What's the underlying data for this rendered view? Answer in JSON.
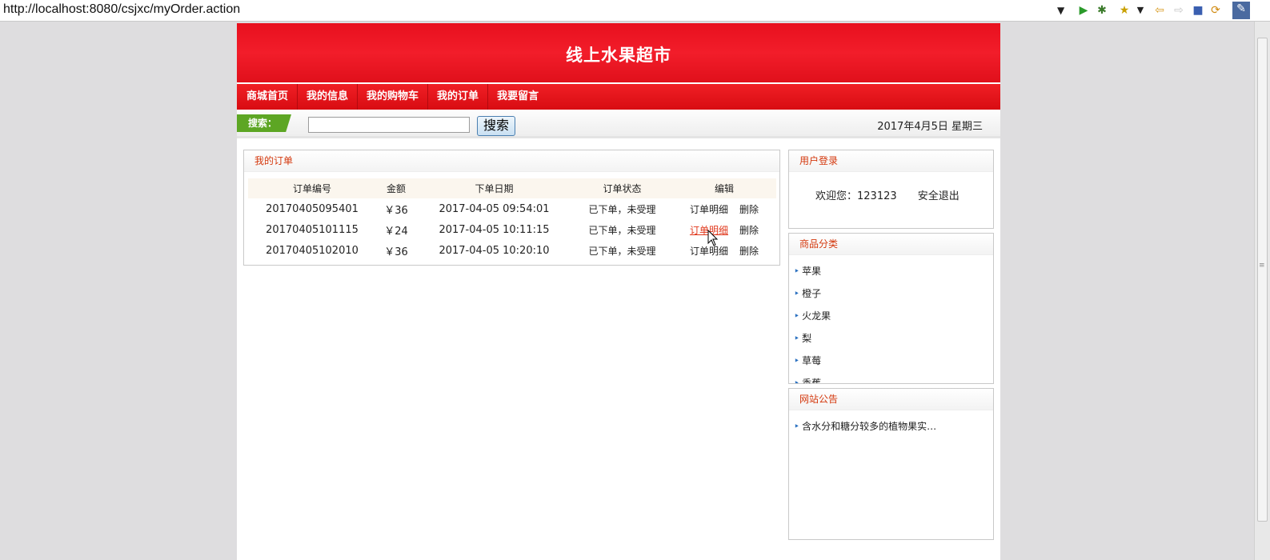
{
  "browser": {
    "url": "http://localhost:8080/csjxc/myOrder.action",
    "icons": [
      "dropdown-icon",
      "run-icon",
      "debug-icon",
      "bookmark-star-icon",
      "menu-arrow-icon",
      "back-icon",
      "forward-icon",
      "stop-icon",
      "refresh-icon",
      "tools-icon"
    ]
  },
  "site": {
    "title": "线上水果超市",
    "nav": [
      "商城首页",
      "我的信息",
      "我的购物车",
      "我的订单",
      "我要留言"
    ]
  },
  "search": {
    "label": "搜索：",
    "value": "",
    "button": "搜索",
    "date": "2017年4月5日  星期三"
  },
  "orders": {
    "title": "我的订单",
    "columns": [
      "订单编号",
      "金额",
      "下单日期",
      "订单状态",
      "编辑"
    ],
    "rows": [
      {
        "id": "20170405095401",
        "amount": "￥36",
        "date": "2017-04-05 09:54:01",
        "status": "已下单，未受理",
        "detail": "订单明细",
        "delete": "删除"
      },
      {
        "id": "20170405101115",
        "amount": "￥24",
        "date": "2017-04-05 10:11:15",
        "status": "已下单，未受理",
        "detail": "订单明细",
        "delete": "删除"
      },
      {
        "id": "20170405102010",
        "amount": "￥36",
        "date": "2017-04-05 10:20:10",
        "status": "已下单，未受理",
        "detail": "订单明细",
        "delete": "删除"
      }
    ]
  },
  "login": {
    "title": "用户登录",
    "welcome": "欢迎您：123123",
    "logout": "安全退出"
  },
  "categories": {
    "title": "商品分类",
    "items": [
      "苹果",
      "橙子",
      "火龙果",
      "梨",
      "草莓",
      "香蕉"
    ]
  },
  "notice": {
    "title": "网站公告",
    "items": [
      "含水分和糖分较多的植物果实…"
    ]
  },
  "colors": {
    "banner": "#ee1622",
    "accent": "#d4380d",
    "search_tag": "#5da624"
  }
}
